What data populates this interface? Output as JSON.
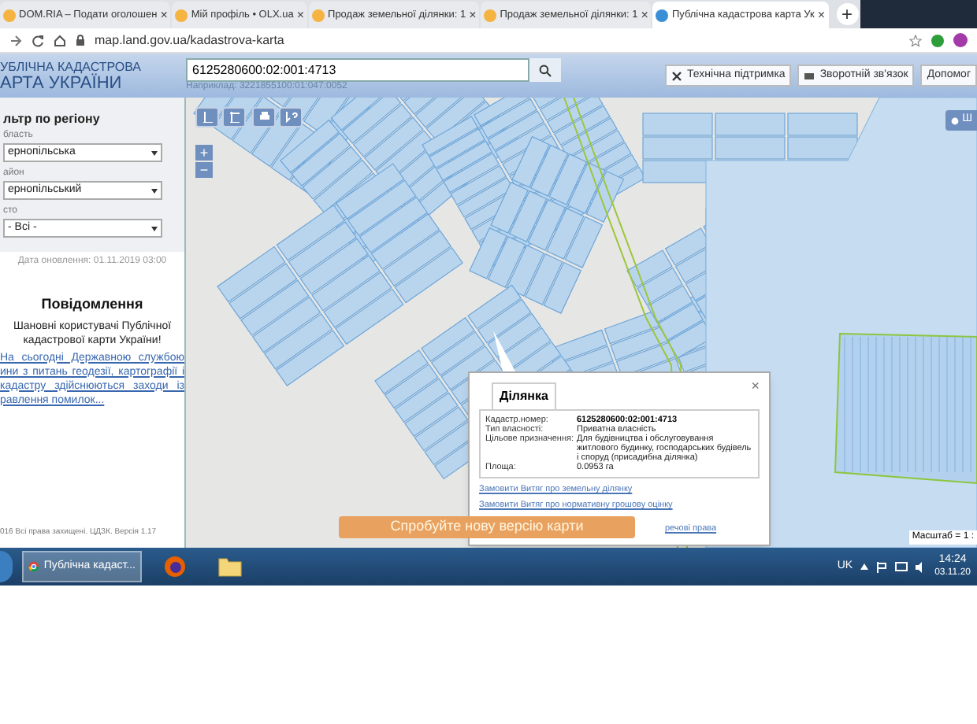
{
  "browser": {
    "tabs": [
      {
        "title": "DOM.RIA – Подати оголошен",
        "close": "×",
        "selected": false
      },
      {
        "title": "Мій профіль • OLX.ua",
        "close": "×",
        "selected": false
      },
      {
        "title": "Продаж земельної ділянки: 1",
        "close": "×",
        "selected": false
      },
      {
        "title": "Продаж земельної ділянки: 1",
        "close": "×",
        "selected": false
      },
      {
        "title": "Публічна кадастрова карта Ук",
        "close": "×",
        "selected": true
      }
    ],
    "new_tab": "+",
    "url": "map.land.gov.ua/kadastrova-karta"
  },
  "header": {
    "logo": [
      "УБЛІЧНА КАДАСТРОВА",
      "АРТА УКРАЇНИ"
    ],
    "search": {
      "value": "6125280600:02:001:4713",
      "hint": "Наприклад: 3221855100:01:047:0052"
    },
    "buttons": [
      "Технічна підтримка",
      "Зворотній зв'язок",
      "Допомог"
    ]
  },
  "sidebar": {
    "filter_title": "льтр по регіону",
    "fields": [
      {
        "label": "бласть",
        "value": "ернопільська"
      },
      {
        "label": "айон",
        "value": "ернопільський"
      },
      {
        "label": "сто",
        "value": "- Всі -"
      }
    ],
    "updated": "Дата оновлення: 01.11.2019 03:00",
    "notice_title": "Повідомлення",
    "notice_greeting": "Шановні користувачі Публічної кадастрової карти України!",
    "notice_link": "На сьогодні Державною службою ини з питань геодезії, картографії і кадастру здійснюються заходи із равлення помилок...",
    "footer": "016 Всі права захищені. ЦДЗК. Версія 1.17"
  },
  "map": {
    "zoom_in": "+",
    "zoom_out": "−",
    "layers_button": "Ш",
    "popup": {
      "tab": "Ділянка",
      "close": "×",
      "rows": [
        {
          "label": "Кадастр.номер:",
          "value": "6125280600:02:001:4713"
        },
        {
          "label": "Тип власності:",
          "value": "Приватна власність"
        },
        {
          "label": "Цільове призначення:",
          "value": "Для будівництва і обслуговування житлового будинку, господарських будівель і споруд (присадибна ділянка)"
        },
        {
          "label": "Площа:",
          "value": "0.0953 га"
        }
      ],
      "links": [
        "Замовити Витяг про земельну ділянку",
        "Замовити Витяг про нормативну грошову оцінку",
        "речові права"
      ]
    },
    "banner": "Спробуйте нову версію карти",
    "scale": "Масштаб = 1 :"
  },
  "taskbar": {
    "active_app": "Публічна кадаст...",
    "language": "UK",
    "time": "14:24",
    "date": "03.11.20"
  }
}
